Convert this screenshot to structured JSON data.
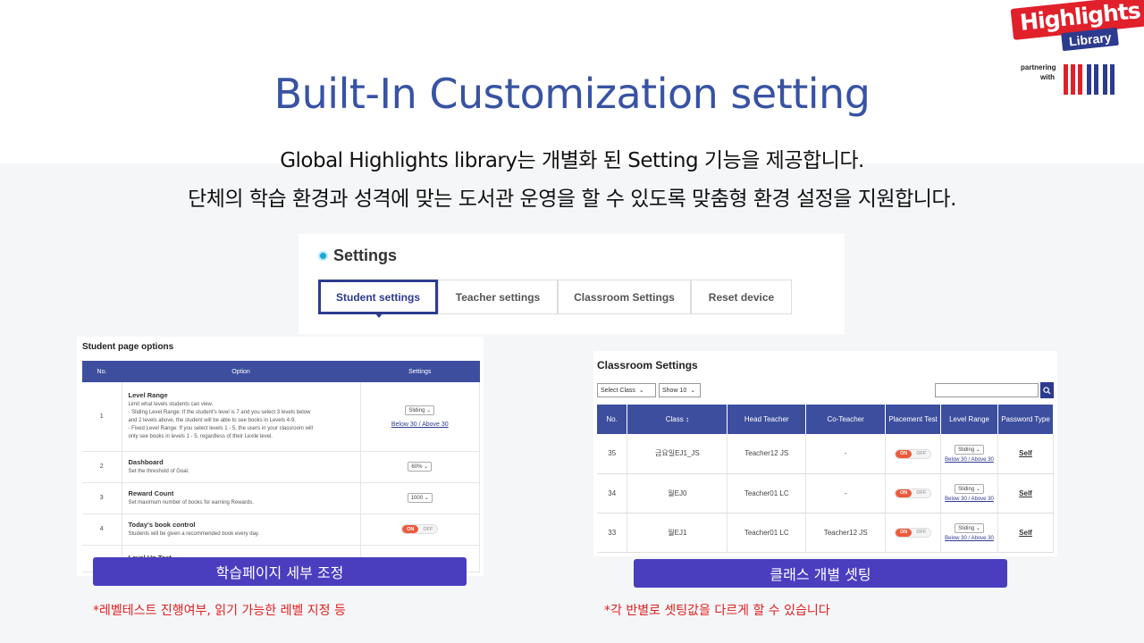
{
  "logo": {
    "main": "Highlights",
    "sub": "Library",
    "partner": "partnering with",
    "colors": {
      "red": "#e0202a",
      "navy": "#2d3b8f"
    }
  },
  "title": "Built-In Customization setting",
  "subtitle1": "Global Highlights library는 개별화 된 Setting 기능을 제공합니다.",
  "subtitle2": "단체의 학습 환경과 성격에 맞는 도서관 운영을 할 수 있도록 맞춤형 환경 설정을 지원합니다.",
  "settings": {
    "heading": "Settings",
    "tabs": [
      {
        "label": "Student settings",
        "active": true
      },
      {
        "label": "Teacher settings"
      },
      {
        "label": "Classroom Settings"
      },
      {
        "label": "Reset device"
      }
    ]
  },
  "student_page": {
    "title": "Student page options",
    "headers": [
      "No.",
      "Option",
      "Settings"
    ],
    "rows": [
      {
        "no": "1",
        "name": "Level Range",
        "desc": [
          "Limit what levels students can view.",
          "- Sliding Level Range: If the student's level is 7 and you select 3 levels below",
          "and 2 levels above, the student will be able to see books in Levels 4-9.",
          "- Fixed Level Range: If you select levels 1 - 5, the users in your classroom will",
          "only see books in levels 1 - 5, regardless of their Lexile level."
        ],
        "select": "Sliding",
        "link": "Below 30 / Above 30"
      },
      {
        "no": "2",
        "name": "Dashboard",
        "desc": [
          "Set the threshold of Goal."
        ],
        "select": "60%"
      },
      {
        "no": "3",
        "name": "Reward Count",
        "desc": [
          "Set maximum number of books for earning Rewards."
        ],
        "select": "1000"
      },
      {
        "no": "4",
        "name": "Today's book control",
        "desc": [
          "Students will be given a recommended book every day."
        ],
        "toggle_on": "ON",
        "toggle_off": "OFF"
      },
      {
        "no": "",
        "name": "Level Up Test",
        "desc": [
          ""
        ]
      }
    ]
  },
  "classroom": {
    "title": "Classroom Settings",
    "filter_class": "Select Class",
    "filter_show": "Show 10",
    "headers": [
      "No.",
      "Class",
      "Head Teacher",
      "Co-Teacher",
      "Placement Test",
      "Level Range",
      "Password Type"
    ],
    "sort_icon": "↕",
    "rows": [
      {
        "no": "35",
        "class": "금요일EJ1_JS",
        "head": "Teacher12 JS",
        "co": "-",
        "on": "ON",
        "off": "OFF",
        "range": "Sliding",
        "range_link": "Below 30 / Above 30",
        "pw": "Self"
      },
      {
        "no": "34",
        "class": "월EJ0",
        "head": "Teacher01 LC",
        "co": "-",
        "on": "ON",
        "off": "OFF",
        "range": "Sliding",
        "range_link": "Below 30 / Above 30",
        "pw": "Self"
      },
      {
        "no": "33",
        "class": "월EJ1",
        "head": "Teacher01 LC",
        "co": "Teacher12 JS",
        "on": "ON",
        "off": "OFF",
        "range": "Sliding",
        "range_link": "Below 30 / Above 30",
        "pw": "Self"
      }
    ]
  },
  "banner_left": "학습페이지 세부 조정",
  "banner_right": "클래스 개별 셋팅",
  "note_left": "*레벨테스트 진행여부, 읽기 가능한 레벨 지정 등",
  "note_right": "*각 반별로 셋팅값을 다르게 할 수 있습니다",
  "icons": {
    "search": "search-icon",
    "caret": "chevron-down-icon",
    "dot": "bullet-icon"
  }
}
